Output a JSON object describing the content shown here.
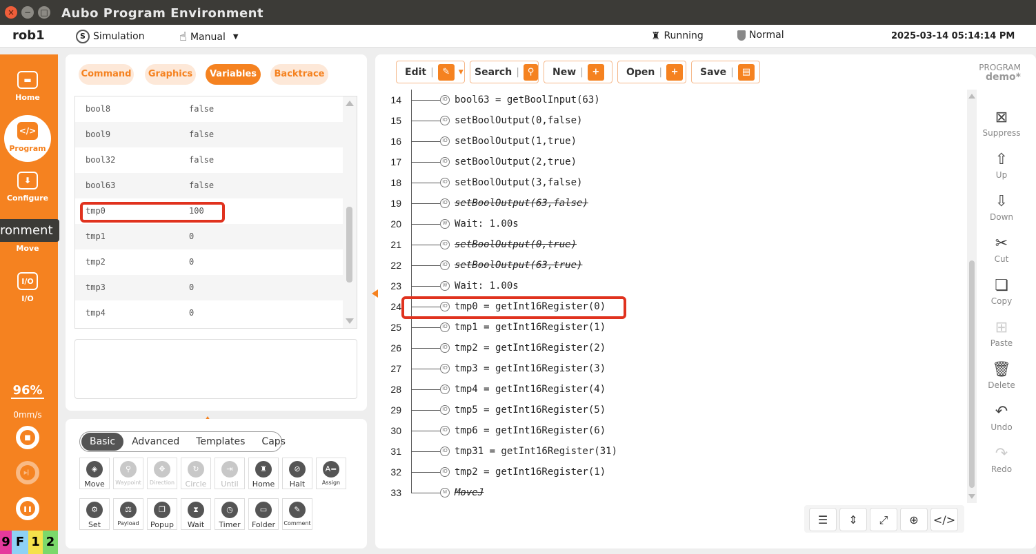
{
  "window": {
    "title": "Aubo Program Environment",
    "close": "×",
    "minimize": "−",
    "maximize": "□"
  },
  "topbar": {
    "robot": "rob1",
    "mode_icon": "S",
    "mode": "Simulation",
    "control": "Manual",
    "control_arrow": "▼",
    "state": "Running",
    "safety": "Normal",
    "datetime": "2025-03-14 05:14:14 PM"
  },
  "sidebar": {
    "items": [
      {
        "label": "Home",
        "icon": "home-icon",
        "glyph": "▬"
      },
      {
        "label": "Program",
        "icon": "code-icon",
        "glyph": "</>"
      },
      {
        "label": "Configure",
        "icon": "download-icon",
        "glyph": "⬇"
      },
      {
        "label": "Move",
        "icon": "move-icon",
        "glyph": "✥"
      },
      {
        "label": "I/O",
        "icon": "io-icon",
        "glyph": "I/O"
      }
    ],
    "tooltip": "ronment",
    "speed_percent": "96%",
    "tcp_speed": "0mm/s",
    "stop_glyph": "■",
    "step_glyph": "▶▎",
    "pause_glyph": "❚❚"
  },
  "keyboard_overlay": [
    "9",
    "F",
    "1",
    "2"
  ],
  "left_tabs": [
    "Command",
    "Graphics",
    "Variables",
    "Backtrace"
  ],
  "variables": [
    {
      "name": "bool8",
      "value": "false"
    },
    {
      "name": "bool9",
      "value": "false"
    },
    {
      "name": "bool32",
      "value": "false"
    },
    {
      "name": "bool63",
      "value": "false"
    },
    {
      "name": "tmp0",
      "value": "100"
    },
    {
      "name": "tmp1",
      "value": "0"
    },
    {
      "name": "tmp2",
      "value": "0"
    },
    {
      "name": "tmp3",
      "value": "0"
    },
    {
      "name": "tmp4",
      "value": "0"
    }
  ],
  "palette": {
    "tabs": [
      "Basic",
      "Advanced",
      "Templates",
      "Caps"
    ],
    "row1": [
      {
        "label": "Move",
        "glyph": "◈",
        "small": false,
        "disabled": false
      },
      {
        "label": "Waypoint",
        "glyph": "⚲",
        "small": true,
        "disabled": true
      },
      {
        "label": "Direction",
        "glyph": "✥",
        "small": true,
        "disabled": true
      },
      {
        "label": "Circle",
        "glyph": "↻",
        "small": false,
        "disabled": true
      },
      {
        "label": "Until",
        "glyph": "⇥",
        "small": false,
        "disabled": true
      },
      {
        "label": "Home",
        "glyph": "♜",
        "small": false,
        "disabled": false
      },
      {
        "label": "Halt",
        "glyph": "⊘",
        "small": false,
        "disabled": false
      },
      {
        "label": "Assign",
        "glyph": "A=",
        "small": true,
        "disabled": false
      }
    ],
    "row2": [
      {
        "label": "Set",
        "glyph": "⚙",
        "small": false,
        "disabled": false
      },
      {
        "label": "Payload",
        "glyph": "⚖",
        "small": true,
        "disabled": false
      },
      {
        "label": "Popup",
        "glyph": "❐",
        "small": false,
        "disabled": false
      },
      {
        "label": "Wait",
        "glyph": "⧗",
        "small": false,
        "disabled": false
      },
      {
        "label": "Timer",
        "glyph": "◷",
        "small": false,
        "disabled": false
      },
      {
        "label": "Folder",
        "glyph": "▭",
        "small": false,
        "disabled": false
      },
      {
        "label": "Comment",
        "glyph": "✎",
        "small": true,
        "disabled": false
      }
    ]
  },
  "toolbar": {
    "edit": "Edit",
    "search": "Search",
    "new": "New",
    "open": "Open",
    "save": "Save",
    "separator": "|",
    "edit_glyph": "✎",
    "search_glyph": "⚲",
    "new_glyph": "+",
    "open_glyph": "+",
    "save_glyph": "▤"
  },
  "program": {
    "label": "PROGRAM",
    "name": "demo*"
  },
  "code": [
    {
      "ln": "14",
      "text": "bool63 = getBoolInput(63)",
      "sup": false,
      "glyph": "IO"
    },
    {
      "ln": "15",
      "text": "setBoolOutput(0,false)",
      "sup": false,
      "glyph": "IO"
    },
    {
      "ln": "16",
      "text": "setBoolOutput(1,true)",
      "sup": false,
      "glyph": "IO"
    },
    {
      "ln": "17",
      "text": "setBoolOutput(2,true)",
      "sup": false,
      "glyph": "IO"
    },
    {
      "ln": "18",
      "text": "setBoolOutput(3,false)",
      "sup": false,
      "glyph": "IO"
    },
    {
      "ln": "19",
      "text": "setBoolOutput(63,false)",
      "sup": true,
      "glyph": "IO"
    },
    {
      "ln": "20",
      "text": "Wait: 1.00s",
      "sup": false,
      "glyph": "W"
    },
    {
      "ln": "21",
      "text": "setBoolOutput(0,true)",
      "sup": true,
      "glyph": "IO"
    },
    {
      "ln": "22",
      "text": "setBoolOutput(63,true)",
      "sup": true,
      "glyph": "IO"
    },
    {
      "ln": "23",
      "text": "Wait: 1.00s",
      "sup": false,
      "glyph": "W"
    },
    {
      "ln": "24",
      "text": "tmp0 = getInt16Register(0)",
      "sup": false,
      "glyph": "IO"
    },
    {
      "ln": "25",
      "text": "tmp1 = getInt16Register(1)",
      "sup": false,
      "glyph": "IO"
    },
    {
      "ln": "26",
      "text": "tmp2 = getInt16Register(2)",
      "sup": false,
      "glyph": "IO"
    },
    {
      "ln": "27",
      "text": "tmp3 = getInt16Register(3)",
      "sup": false,
      "glyph": "IO"
    },
    {
      "ln": "28",
      "text": "tmp4 = getInt16Register(4)",
      "sup": false,
      "glyph": "IO"
    },
    {
      "ln": "29",
      "text": "tmp5 = getInt16Register(5)",
      "sup": false,
      "glyph": "IO"
    },
    {
      "ln": "30",
      "text": "tmp6 = getInt16Register(6)",
      "sup": false,
      "glyph": "IO"
    },
    {
      "ln": "31",
      "text": "tmp31 = getInt16Register(31)",
      "sup": false,
      "glyph": "IO"
    },
    {
      "ln": "32",
      "text": "tmp2 = getInt16Register(1)",
      "sup": false,
      "glyph": "IO"
    },
    {
      "ln": "33",
      "text": "MoveJ",
      "sup": true,
      "glyph": "M"
    }
  ],
  "right_actions": [
    {
      "label": "Suppress",
      "glyph": "⊠",
      "disabled": false
    },
    {
      "label": "Up",
      "glyph": "⇧",
      "disabled": false
    },
    {
      "label": "Down",
      "glyph": "⇩",
      "disabled": false
    },
    {
      "label": "Cut",
      "glyph": "✂",
      "disabled": false
    },
    {
      "label": "Copy",
      "glyph": "❏",
      "disabled": false
    },
    {
      "label": "Paste",
      "glyph": "⊞",
      "disabled": true
    },
    {
      "label": "Delete",
      "glyph": "🗑",
      "disabled": false
    },
    {
      "label": "Undo",
      "glyph": "↶",
      "disabled": false
    },
    {
      "label": "Redo",
      "glyph": "↷",
      "disabled": true
    }
  ],
  "bottom_tools": [
    {
      "name": "sort-icon",
      "glyph": "☰"
    },
    {
      "name": "collapse-icon",
      "glyph": "⇕"
    },
    {
      "name": "expand-icon",
      "glyph": "⤢"
    },
    {
      "name": "locate-icon",
      "glyph": "⊕"
    },
    {
      "name": "code-view-icon",
      "glyph": "</>"
    }
  ],
  "colors": {
    "accent": "#f58220",
    "highlight": "#e0321e",
    "titlebar": "#3c3b37"
  }
}
